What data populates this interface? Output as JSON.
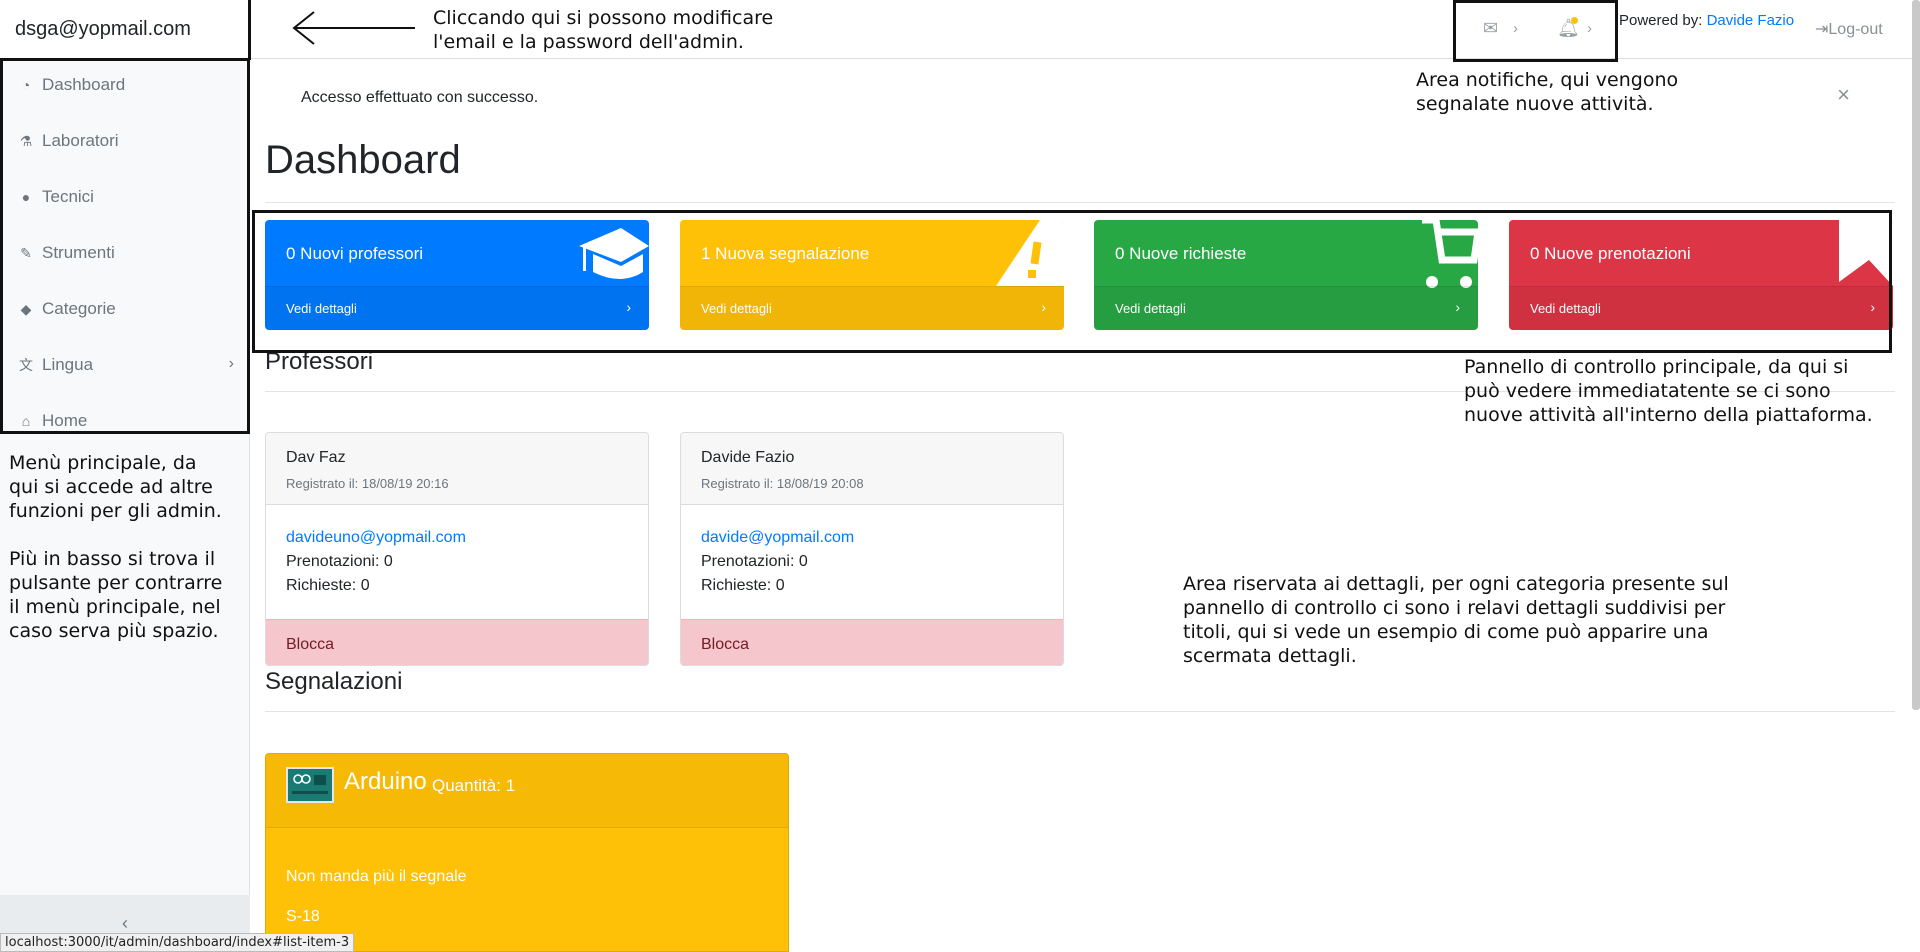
{
  "sidebar": {
    "user_email": "dsga@yopmail.com",
    "items": [
      {
        "label": "Dashboard",
        "icon": "dashboard-icon"
      },
      {
        "label": "Laboratori",
        "icon": "flask-icon"
      },
      {
        "label": "Tecnici",
        "icon": "users-icon"
      },
      {
        "label": "Strumenti",
        "icon": "wrench-icon"
      },
      {
        "label": "Categorie",
        "icon": "tag-icon"
      },
      {
        "label": "Lingua",
        "icon": "language-icon"
      },
      {
        "label": "Home",
        "icon": "home-icon"
      }
    ],
    "collapse_icon": "chevron-left-icon"
  },
  "topbar": {
    "powered_prefix": "Powered by:",
    "powered_name": "Davide Fazio",
    "logout": "Log-out",
    "notification_dot_color": "#ffc107"
  },
  "alert": {
    "text": "Accesso effettuato con successo.",
    "close": "×"
  },
  "page_title": "Dashboard",
  "cards": [
    {
      "title": "0 Nuovi professori",
      "footer": "Vedi dettagli",
      "color": "#007bff",
      "icon": "graduation-cap-icon"
    },
    {
      "title": "1 Nuova segnalazione",
      "footer": "Vedi dettagli",
      "color": "#ffc107",
      "icon": "warning-icon"
    },
    {
      "title": "0 Nuove richieste",
      "footer": "Vedi dettagli",
      "color": "#28a745",
      "icon": "cart-icon"
    },
    {
      "title": "0 Nuove prenotazioni",
      "footer": "Vedi dettagli",
      "color": "#dc3545",
      "icon": "bookmark-icon"
    }
  ],
  "sections": {
    "professori": "Professori",
    "segnalazioni": "Segnalazioni"
  },
  "professors": [
    {
      "name": "Dav Faz",
      "registered": "Registrato il: 18/08/19 20:16",
      "email": "davideuno@yopmail.com",
      "prenotazioni": "Prenotazioni: 0",
      "richieste": "Richieste: 0",
      "action": "Blocca"
    },
    {
      "name": "Davide Fazio",
      "registered": "Registrato il: 18/08/19 20:08",
      "email": "davide@yopmail.com",
      "prenotazioni": "Prenotazioni: 0",
      "richieste": "Richieste: 0",
      "action": "Blocca"
    }
  ],
  "report": {
    "name": "Arduino",
    "qty": "Quantità: 1",
    "description": "Non manda più il segnale",
    "code": "S-18"
  },
  "annotations": {
    "top": "Cliccando qui si possono modificare\nl'email e la password dell'admin.",
    "notif": "Area notifiche, qui vengono\nsegnalate nuove attività.",
    "panel": "Pannello di controllo principale, da qui si\npuò vedere immediatatente se ci sono\nnuove attività all'interno della piattaforma.",
    "menu": "Menù principale, da\nqui si accede ad altre\nfunzioni per gli admin.\n\nPiù in basso si trova il\npulsante per contrarre\nil menù principale, nel\ncaso serva più spazio.",
    "details": "Area riservata ai dettagli, per ogni categoria presente sul\npannello di controllo ci sono i relavi dettagli suddivisi per\ntitoli, qui si vede un esempio di come può apparire una\nscermata dettagli."
  },
  "status_url": "localhost:3000/it/admin/dashboard/index#list-item-3"
}
